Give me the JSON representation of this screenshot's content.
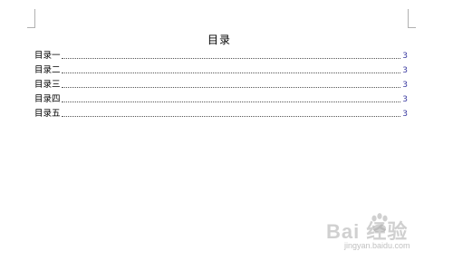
{
  "document": {
    "title": "目录",
    "entries": [
      {
        "label": "目录一",
        "page": "3"
      },
      {
        "label": "目录二",
        "page": "3"
      },
      {
        "label": "目录三",
        "page": "3"
      },
      {
        "label": "目录四",
        "page": "3"
      },
      {
        "label": "目录五",
        "page": "3"
      }
    ]
  },
  "watermark": {
    "brand": "Bai 经验",
    "url": "jingyan.baidu.com",
    "icon": "paw-icon"
  },
  "colors": {
    "page_number": "#3a3aa0",
    "text": "#000000",
    "watermark": "#aaaaaa"
  }
}
